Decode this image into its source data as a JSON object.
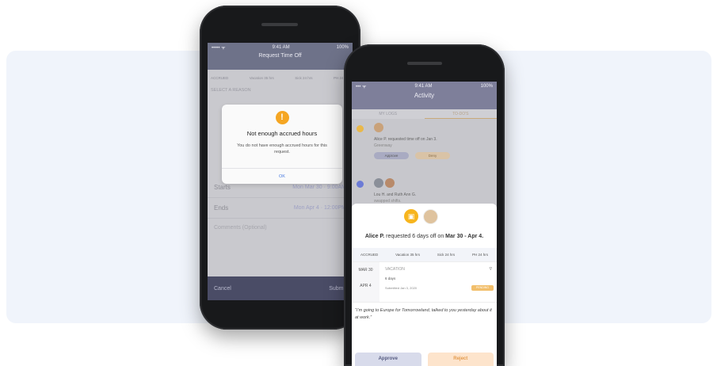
{
  "phone1": {
    "status": {
      "carrier": "••••• ᯤ",
      "time": "9:41 AM",
      "battery": "100%"
    },
    "title": "Request Time Off",
    "accrued": [
      "ACCRUED",
      "Vacation 35 hrs",
      "Sick 24 hrs",
      "PH 24 hrs"
    ],
    "section": "SELECT A REASON",
    "rows": [
      {
        "label": "Starts",
        "value": "Mon Mar 30 · 9:00AM"
      },
      {
        "label": "Ends",
        "value": "Mon Apr 4 · 12:00PM"
      }
    ],
    "comment_placeholder": "Comments (Optional)",
    "footer": {
      "cancel": "Cancel",
      "submit": "Submit"
    },
    "alert": {
      "icon": "!",
      "title": "Not enough accrued hours",
      "message": "You do not have enough accrued hours for this request.",
      "ok": "OK"
    }
  },
  "phone2": {
    "status": {
      "carrier": "••• ᯤ",
      "time": "9:41 AM",
      "battery": "100%"
    },
    "title": "Activity",
    "tabs": [
      "MY LOGS",
      "TO-DO'S"
    ],
    "item1": {
      "text": "Alice P. requested time off on Jan 3.",
      "sub": "Greenway",
      "approve": "Approve",
      "deny": "Deny",
      "time": "2:17"
    },
    "item2": {
      "text": "Lou H. and Ruth Ann G.",
      "sub": "swapped shifts."
    },
    "sheet": {
      "name": "Alice P.",
      "middle": "requested 6 days off on",
      "range": "Mar 30 - Apr 4.",
      "chips": [
        "ACCRUED",
        "Vacation 35 hrs",
        "Sick 24 hrs",
        "PH 24 hrs"
      ],
      "date_start": "MAR 30",
      "date_end": "APR 4",
      "type": "VACATION",
      "days": "6 days",
      "submitted": "Submitted Jan 3, 2020",
      "status": "PENDING",
      "quote": "“I’m going to Europe for Tomorrowland, talked to you yesterday about it at work.”",
      "approve": "Approve",
      "reject": "Reject"
    }
  }
}
